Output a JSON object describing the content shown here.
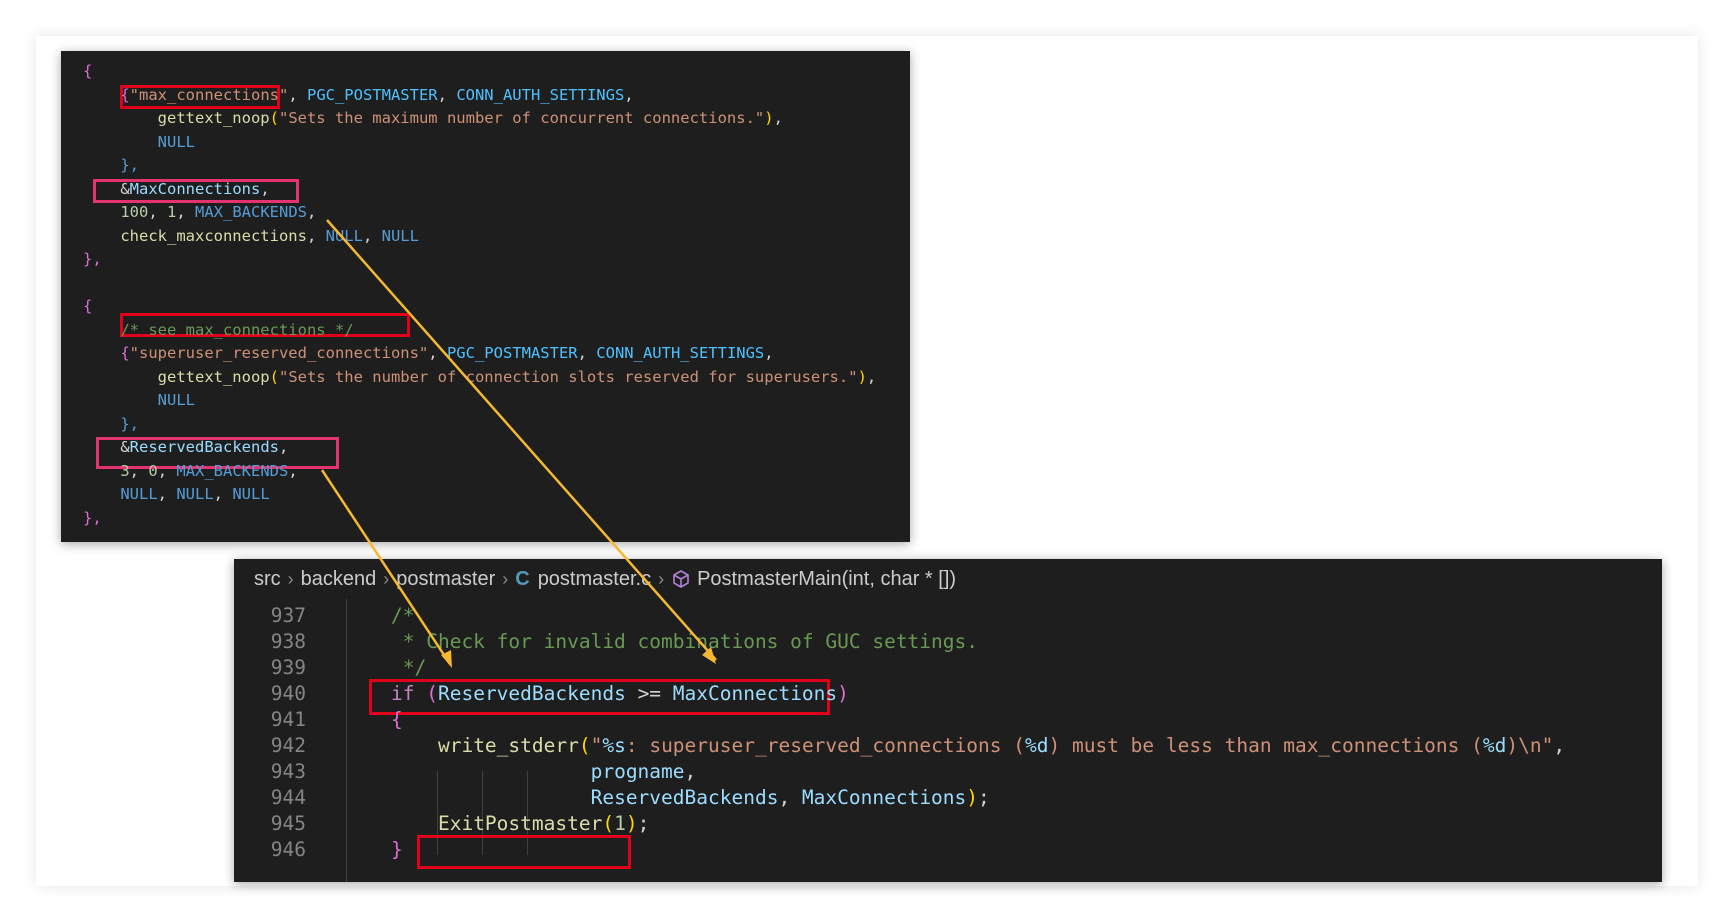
{
  "colors": {
    "brace": "#da70d6",
    "string": "#ce9178",
    "func": "#dcdcaa",
    "const": "#4fc1ff",
    "keyword_const": "#569cd6",
    "variable": "#9cdcfe",
    "number": "#b5cea8",
    "comment": "#6a9955",
    "plain": "#d4d4d4",
    "paren_yellow": "#ffd700",
    "control": "#c586c0",
    "highlight_red": "#e0001b",
    "highlight_pink": "#e4336f",
    "arrow": "#f5b833"
  },
  "top_snippet": {
    "lines": [
      [
        {
          "t": "{",
          "c": "brace"
        }
      ],
      [
        {
          "t": "    "
        },
        {
          "t": "{",
          "c": "brace"
        },
        {
          "t": "\"max_connections\"",
          "c": "string"
        },
        {
          "t": ", "
        },
        {
          "t": "PGC_POSTMASTER",
          "c": "const"
        },
        {
          "t": ", "
        },
        {
          "t": "CONN_AUTH_SETTINGS",
          "c": "const"
        },
        {
          "t": ","
        }
      ],
      [
        {
          "t": "        "
        },
        {
          "t": "gettext_noop",
          "c": "func"
        },
        {
          "t": "(",
          "c": "paren_yellow"
        },
        {
          "t": "\"Sets the maximum number of concurrent connections.\"",
          "c": "string"
        },
        {
          "t": ")",
          "c": "paren_yellow"
        },
        {
          "t": ","
        }
      ],
      [
        {
          "t": "        "
        },
        {
          "t": "NULL",
          "c": "keyword_const"
        }
      ],
      [
        {
          "t": "    "
        },
        {
          "t": "},",
          "c": "keyword_const"
        }
      ],
      [
        {
          "t": "    "
        },
        {
          "t": "&"
        },
        {
          "t": "MaxConnections",
          "c": "variable"
        },
        {
          "t": ","
        }
      ],
      [
        {
          "t": "    "
        },
        {
          "t": "100",
          "c": "number"
        },
        {
          "t": ", "
        },
        {
          "t": "1",
          "c": "number"
        },
        {
          "t": ", "
        },
        {
          "t": "MAX_BACKENDS",
          "c": "keyword_const"
        },
        {
          "t": ","
        }
      ],
      [
        {
          "t": "    "
        },
        {
          "t": "check_maxconnections",
          "c": "func"
        },
        {
          "t": ", "
        },
        {
          "t": "NULL",
          "c": "keyword_const"
        },
        {
          "t": ", "
        },
        {
          "t": "NULL",
          "c": "keyword_const"
        }
      ],
      [
        {
          "t": "},",
          "c": "brace"
        }
      ],
      [],
      [
        {
          "t": "{",
          "c": "brace"
        }
      ],
      [
        {
          "t": "    "
        },
        {
          "t": "/* see max_connections */",
          "c": "comment"
        }
      ],
      [
        {
          "t": "    "
        },
        {
          "t": "{",
          "c": "brace"
        },
        {
          "t": "\"superuser_reserved_connections\"",
          "c": "string"
        },
        {
          "t": ", "
        },
        {
          "t": "PGC_POSTMASTER",
          "c": "const"
        },
        {
          "t": ", "
        },
        {
          "t": "CONN_AUTH_SETTINGS",
          "c": "const"
        },
        {
          "t": ","
        }
      ],
      [
        {
          "t": "        "
        },
        {
          "t": "gettext_noop",
          "c": "func"
        },
        {
          "t": "(",
          "c": "paren_yellow"
        },
        {
          "t": "\"Sets the number of connection slots reserved for superusers.\"",
          "c": "string"
        },
        {
          "t": ")",
          "c": "paren_yellow"
        },
        {
          "t": ","
        }
      ],
      [
        {
          "t": "        "
        },
        {
          "t": "NULL",
          "c": "keyword_const"
        }
      ],
      [
        {
          "t": "    "
        },
        {
          "t": "},",
          "c": "keyword_const"
        }
      ],
      [
        {
          "t": "    "
        },
        {
          "t": "&"
        },
        {
          "t": "ReservedBackends",
          "c": "variable"
        },
        {
          "t": ","
        }
      ],
      [
        {
          "t": "    "
        },
        {
          "t": "3",
          "c": "number"
        },
        {
          "t": ", "
        },
        {
          "t": "0",
          "c": "number"
        },
        {
          "t": ", "
        },
        {
          "t": "MAX_BACKENDS",
          "c": "keyword_const"
        },
        {
          "t": ","
        }
      ],
      [
        {
          "t": "    "
        },
        {
          "t": "NULL",
          "c": "keyword_const"
        },
        {
          "t": ", "
        },
        {
          "t": "NULL",
          "c": "keyword_const"
        },
        {
          "t": ", "
        },
        {
          "t": "NULL",
          "c": "keyword_const"
        }
      ],
      [
        {
          "t": "},",
          "c": "brace"
        }
      ]
    ]
  },
  "editor": {
    "breadcrumb": {
      "parts": [
        "src",
        "backend",
        "postmaster"
      ],
      "file_icon_glyph": "C",
      "file_icon": "c-file-icon",
      "file": "postmaster.c",
      "symbol_icon": "cube-icon",
      "symbol": "PostmasterMain(int, char * [])"
    },
    "lines": [
      {
        "num": "937",
        "tokens": [
          {
            "t": "/*",
            "c": "comment"
          }
        ]
      },
      {
        "num": "938",
        "tokens": [
          {
            "t": " * Check for invalid combinations of GUC settings.",
            "c": "comment"
          }
        ]
      },
      {
        "num": "939",
        "tokens": [
          {
            "t": " */",
            "c": "comment"
          }
        ]
      },
      {
        "num": "940",
        "tokens": [
          {
            "t": "if",
            "c": "control"
          },
          {
            "t": " "
          },
          {
            "t": "(",
            "c": "brace"
          },
          {
            "t": "ReservedBackends",
            "c": "variable"
          },
          {
            "t": " >= "
          },
          {
            "t": "MaxConnections",
            "c": "variable"
          },
          {
            "t": ")",
            "c": "brace"
          }
        ]
      },
      {
        "num": "941",
        "tokens": [
          {
            "t": "{",
            "c": "brace"
          }
        ]
      },
      {
        "num": "942",
        "tokens": [
          {
            "t": "    "
          },
          {
            "t": "write_stderr",
            "c": "func"
          },
          {
            "t": "(",
            "c": "paren_yellow"
          },
          {
            "t": "\"",
            "c": "string"
          },
          {
            "t": "%s",
            "c": "variable"
          },
          {
            "t": ": superuser_reserved_connections (",
            "c": "string"
          },
          {
            "t": "%d",
            "c": "variable"
          },
          {
            "t": ") must be less than max_connections (",
            "c": "string"
          },
          {
            "t": "%d",
            "c": "variable"
          },
          {
            "t": ")\\n\"",
            "c": "string"
          },
          {
            "t": ","
          }
        ]
      },
      {
        "num": "943",
        "tokens": [
          {
            "t": "                 "
          },
          {
            "t": "progname",
            "c": "variable"
          },
          {
            "t": ","
          }
        ]
      },
      {
        "num": "944",
        "tokens": [
          {
            "t": "                 "
          },
          {
            "t": "ReservedBackends",
            "c": "variable"
          },
          {
            "t": ", "
          },
          {
            "t": "MaxConnections",
            "c": "variable"
          },
          {
            "t": ")",
            "c": "paren_yellow"
          },
          {
            "t": ";"
          }
        ]
      },
      {
        "num": "945",
        "tokens": [
          {
            "t": "    "
          },
          {
            "t": "ExitPostmaster",
            "c": "func"
          },
          {
            "t": "(",
            "c": "paren_yellow"
          },
          {
            "t": "1",
            "c": "number"
          },
          {
            "t": ")",
            "c": "paren_yellow"
          },
          {
            "t": ";"
          }
        ]
      },
      {
        "num": "946",
        "tokens": [
          {
            "t": "}",
            "c": "brace"
          }
        ]
      }
    ]
  }
}
